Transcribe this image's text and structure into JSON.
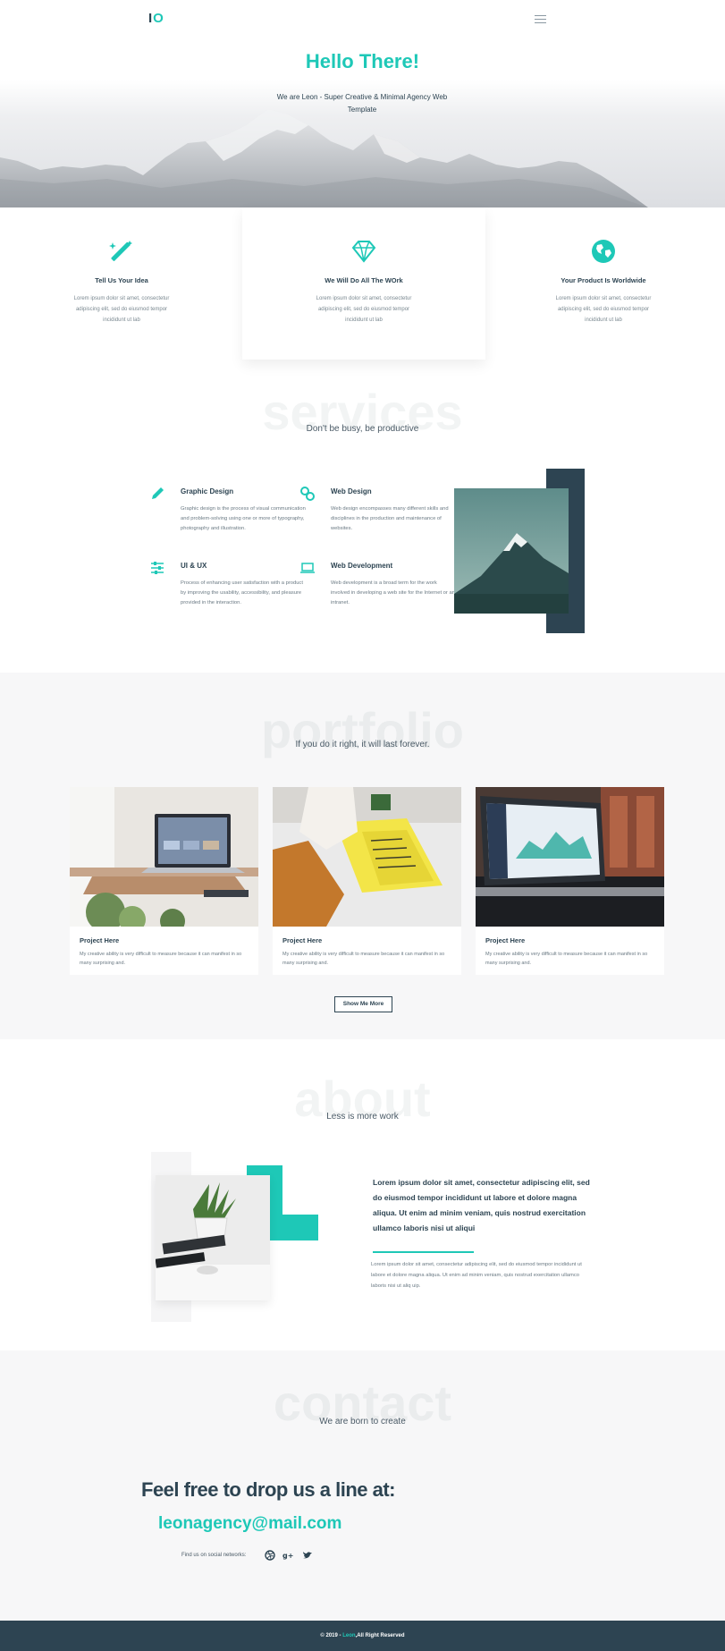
{
  "header": {
    "logo_i": "I",
    "logo_o": "O",
    "menu_icon": "hamburger-menu-icon"
  },
  "hero": {
    "title": "Hello There!",
    "subtitle": "We are Leon - Super Creative & Minimal Agency Web Template"
  },
  "features": [
    {
      "icon": "magic-wand-icon",
      "title": "Tell Us Your Idea",
      "text": "Lorem ipsum dolor sit amet, consectetur adipiscing elit, sed do eiusmod tempor incididunt ut lab"
    },
    {
      "icon": "diamond-icon",
      "title": "We Will Do All The WOrk",
      "text": "Lorem ipsum dolor sit amet, consectetur adipiscing elit, sed do eiusmod tempor incididunt ut lab"
    },
    {
      "icon": "globe-icon",
      "title": "Your Product Is Worldwide",
      "text": "Lorem ipsum dolor sit amet, consectetur adipiscing elit, sed do eiusmod tempor incididunt ut lab"
    }
  ],
  "services": {
    "ghost_title": "services",
    "tagline": "Don't be busy, be productive",
    "items": [
      {
        "icon": "pencil-icon",
        "title": "Graphic Design",
        "text": "Graphic design is the process of visual communication and problem-solving using one or more of typography, photography and illustration."
      },
      {
        "icon": "link-icon",
        "title": "Web Design",
        "text": "Web design encompasses many different skills and disciplines in the production and maintenance of websites."
      },
      {
        "icon": "sliders-icon",
        "title": "UI & UX",
        "text": "Process of enhancing user satisfaction with a product by improving the usability, accessibility, and pleasure provided in the interaction."
      },
      {
        "icon": "laptop-icon",
        "title": "Web Development",
        "text": "Web development is a broad term for the work involved in developing a web site for the Internet or an intranet."
      }
    ]
  },
  "portfolio": {
    "ghost_title": "portfolio",
    "tagline": "If you do it right, it will last forever.",
    "cards": [
      {
        "title": "Project Here",
        "text": "My creative ability is very difficult to measure because it can manifest in so many surprising and."
      },
      {
        "title": "Project Here",
        "text": "My creative ability is very difficult to measure because it can manifest in so many surprising and."
      },
      {
        "title": "Project Here",
        "text": "My creative ability is very difficult to measure because it can manifest in so many surprising and."
      }
    ],
    "button_label": "Show Me More"
  },
  "about": {
    "ghost_title": "about",
    "tagline": "Less is more work",
    "lead": "Lorem ipsum dolor sit amet, consectetur adipiscing elit, sed do eiusmod tempor incididunt ut labore et dolore magna aliqua. Ut enim ad minim veniam, quis nostrud exercitation ullamco laboris nisi ut aliqui",
    "text": "Lorem ipsum dolor sit amet, consectetur adipiscing elit, sed do eiusmod tempor incididunt ut labore et dolore magna aliqua. Ut enim ad minim veniam, quis nostrud exercitation ullamco laboris nisi ut aliq uip."
  },
  "contact": {
    "ghost_title": "contact",
    "tagline": "We are born to create",
    "cta": "Feel free to drop us a line at:",
    "email": "leonagency@mail.com",
    "social_label": "Find us on social networks:",
    "social_icons": [
      "dribbble-icon",
      "google-plus-icon",
      "twitter-icon"
    ]
  },
  "footer": {
    "prefix": "© 2019 - ",
    "brand": "Leon",
    "suffix": ",All Right Reserved"
  },
  "colors": {
    "accent": "#1ec8b7",
    "dark": "#2d4452",
    "light_bg": "#f7f7f8"
  }
}
